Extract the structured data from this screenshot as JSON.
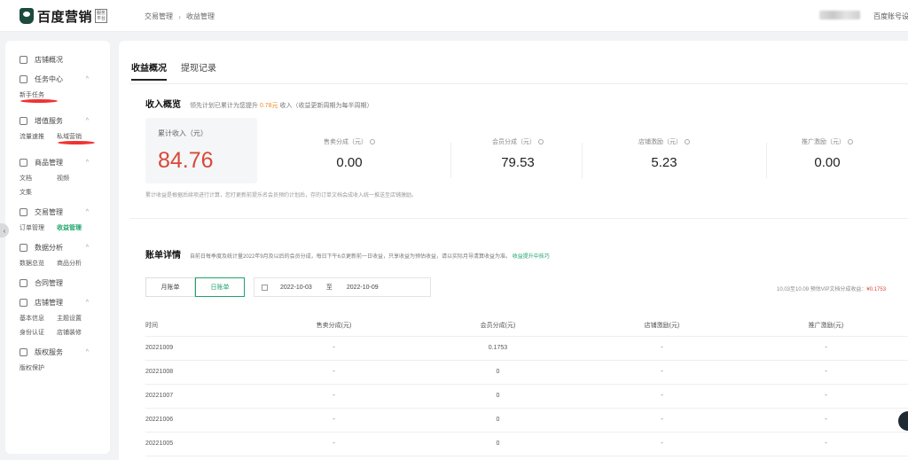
{
  "brand": {
    "name": "百度营销",
    "badge": "服务平台"
  },
  "breadcrumb": [
    "交易管理",
    "收益管理"
  ],
  "header": {
    "account_link": "百度账号设置"
  },
  "sidebar": {
    "groups": [
      {
        "label": "店铺概况",
        "icon": "home-icon",
        "children": []
      },
      {
        "label": "任务中心",
        "icon": "task-icon",
        "children": [
          {
            "label": "新手任务",
            "dot": true
          }
        ]
      },
      {
        "label": "增值服务",
        "icon": "heart-icon",
        "children": [
          {
            "label": "流量速推",
            "dot": false
          },
          {
            "label": "私域营销",
            "dot": true
          }
        ]
      },
      {
        "label": "商品管理",
        "icon": "goods-icon",
        "children": [
          {
            "label": "文档",
            "dot": false
          },
          {
            "label": "视频",
            "dot": false
          },
          {
            "label": "文集",
            "dot": false
          }
        ]
      },
      {
        "label": "交易管理",
        "icon": "trade-icon",
        "children": [
          {
            "label": "订单管理",
            "dot": false
          },
          {
            "label": "收益管理",
            "dot": false,
            "active": true
          }
        ]
      },
      {
        "label": "数据分析",
        "icon": "chart-icon",
        "children": [
          {
            "label": "数据总览",
            "dot": false
          },
          {
            "label": "商品分析",
            "dot": false
          }
        ]
      },
      {
        "label": "合同管理",
        "icon": "contract-icon",
        "children": []
      },
      {
        "label": "店铺管理",
        "icon": "shop-icon",
        "children": [
          {
            "label": "基本信息",
            "dot": false
          },
          {
            "label": "主题设置",
            "dot": false
          },
          {
            "label": "身份认证",
            "dot": false
          },
          {
            "label": "店铺装修",
            "dot": false
          }
        ]
      },
      {
        "label": "版权服务",
        "icon": "copyright-icon",
        "children": [
          {
            "label": "版权保护",
            "dot": false
          }
        ]
      }
    ]
  },
  "tabs": [
    {
      "label": "收益概况",
      "active": true
    },
    {
      "label": "提现记录",
      "active": false
    }
  ],
  "overview": {
    "title": "收入概览",
    "note_prefix": "领先计划已累计为您提升",
    "note_amount": "0.78元",
    "note_suffix": "收入（收益更新周期为每半周期）",
    "total_label": "累计收入（元）",
    "total_value": "84.76",
    "stats": [
      {
        "label": "售卖分成（元）",
        "value": "0.00"
      },
      {
        "label": "会员分成（元）",
        "value": "79.53"
      },
      {
        "label": "店铺激励（元）",
        "value": "5.23"
      },
      {
        "label": "推广激励（元）",
        "value": "0.00"
      }
    ],
    "footnote": "累计收益是根据后续项进行计算，您打更新前提乐名会员预约计划后，存的订单文档会成收入统一推送至店铺激励。"
  },
  "bill": {
    "title": "账单详情",
    "note": "自前日每季度及统计量2022年9月及以后的会员分成，每日下午6点更新前一日收益，只享收益为预估收益，请以实际月导清算收益为准。",
    "note_link": "收益提升中技巧",
    "segments": [
      {
        "label": "月账单",
        "on": false
      },
      {
        "label": "日账单",
        "on": true
      }
    ],
    "date_from": "2022-10-03",
    "date_sep": "至",
    "date_to": "2022-10-09",
    "summary_text": "10.03至10.09 预估VIP文档分成收益：",
    "summary_value": "¥0.1753",
    "columns": [
      "时间",
      "售卖分成(元)",
      "会员分成(元)",
      "店铺激励(元)",
      "推广激励(元)"
    ],
    "rows": [
      [
        "20221009",
        "-",
        "0.1753",
        "-",
        "-"
      ],
      [
        "20221008",
        "-",
        "0",
        "-",
        "-"
      ],
      [
        "20221007",
        "-",
        "0",
        "-",
        "-"
      ],
      [
        "20221006",
        "-",
        "0",
        "-",
        "-"
      ],
      [
        "20221005",
        "-",
        "0",
        "-",
        "-"
      ]
    ]
  }
}
